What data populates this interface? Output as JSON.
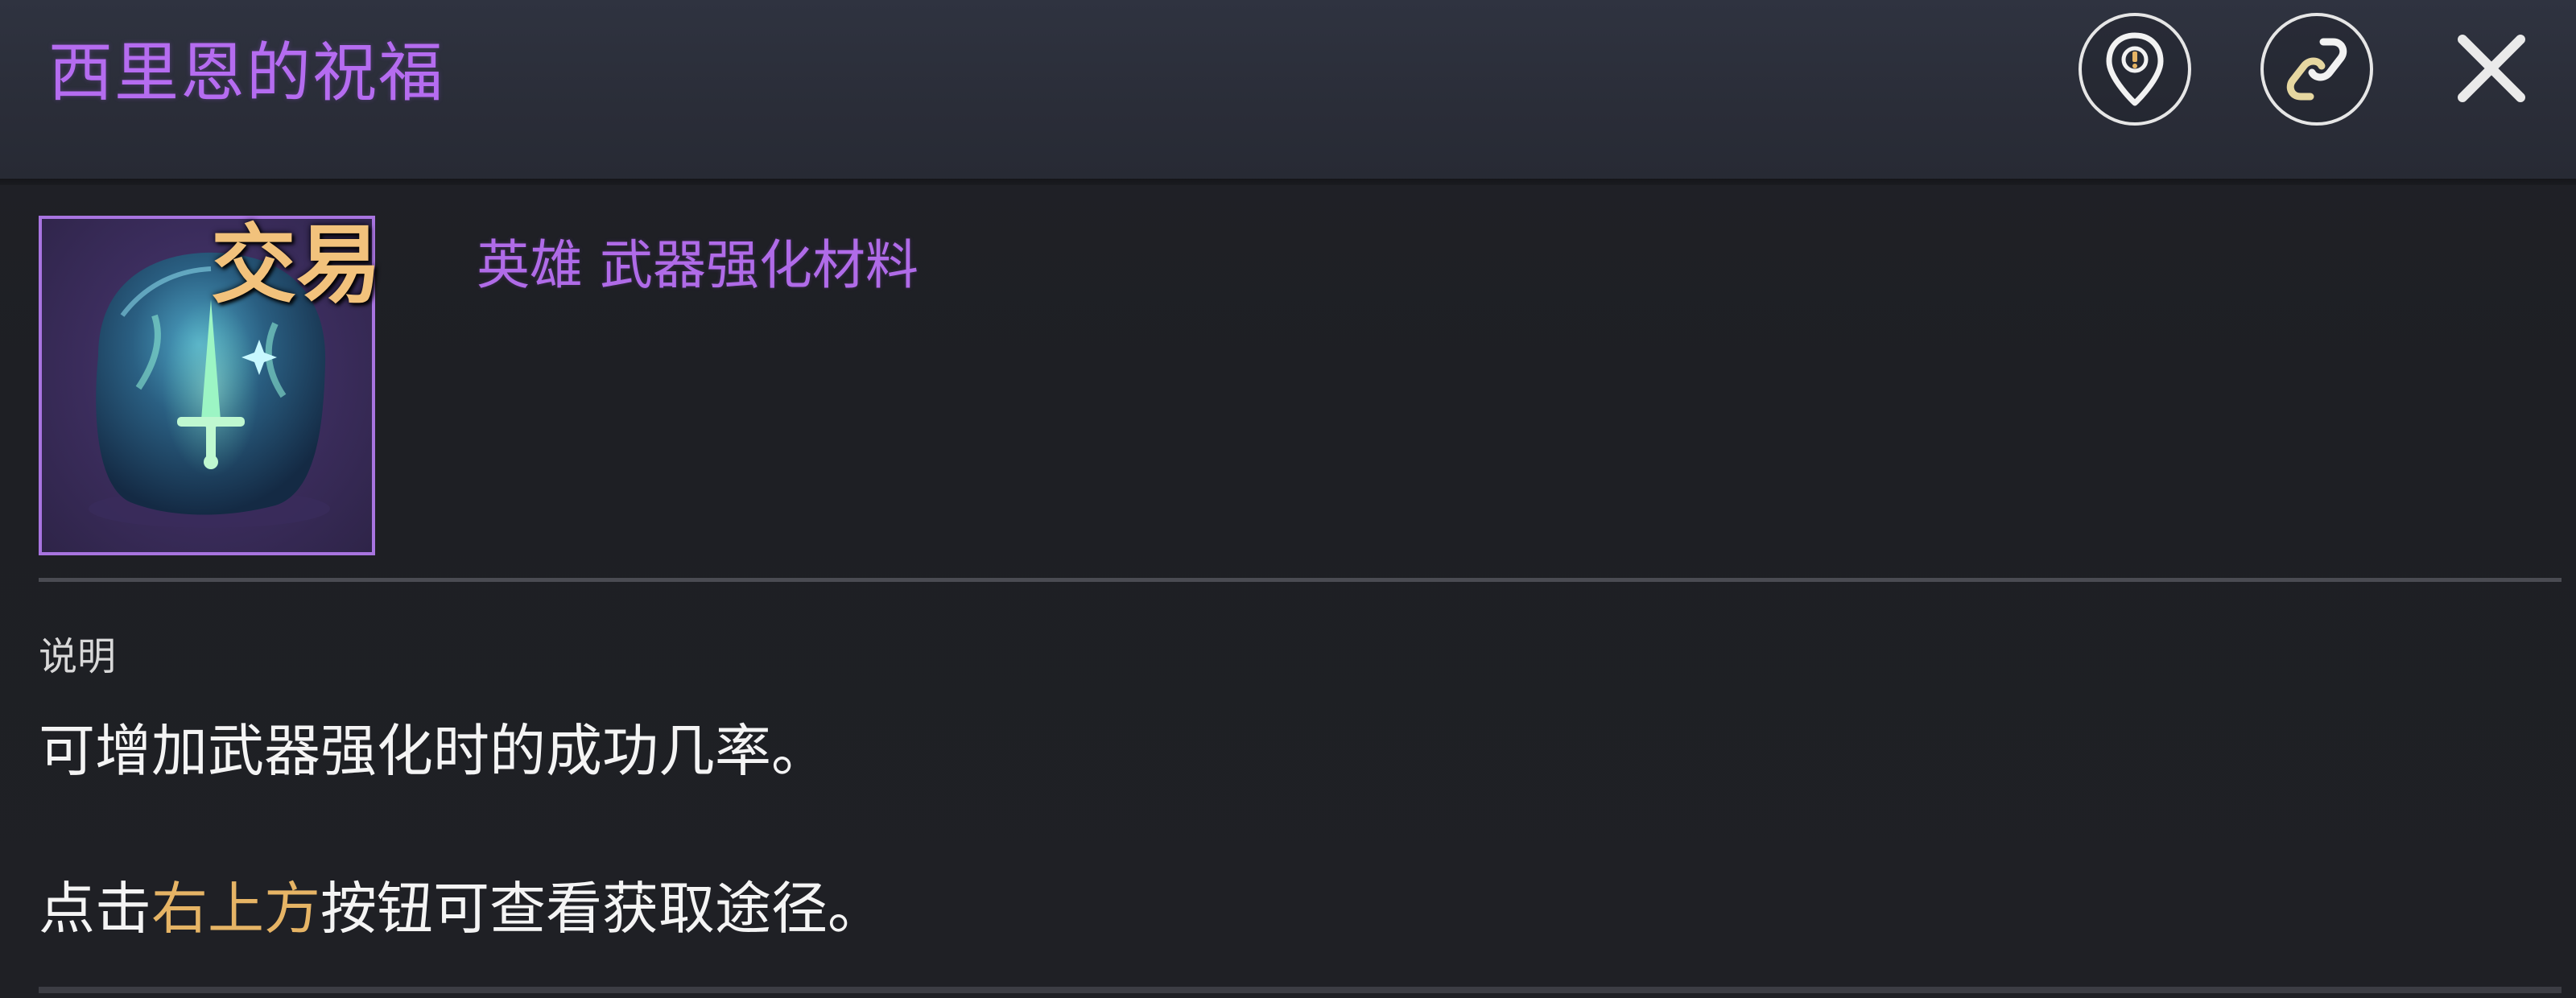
{
  "header": {
    "title": "西里恩的祝福",
    "map_button_icon": "map-pin-icon",
    "link_button_icon": "chain-link-icon",
    "close_icon": "close-icon"
  },
  "item": {
    "icon": "weapon-enhance-stone-icon",
    "trade_tag": "交易",
    "type_label": "英雄 武器强化材料"
  },
  "description": {
    "label": "说明",
    "line1": "可增加武器强化时的成功几率。",
    "line2_prefix": "点击",
    "line2_highlight": "右上方",
    "line2_suffix": "按钮可查看获取途径。"
  },
  "colors": {
    "title": "#b56cf0",
    "rarity_purple": "#a874e0",
    "trade_tag": "#f2c27c",
    "highlight": "#e6b465",
    "text": "#f4f4f4",
    "background": "#1e1f24"
  }
}
